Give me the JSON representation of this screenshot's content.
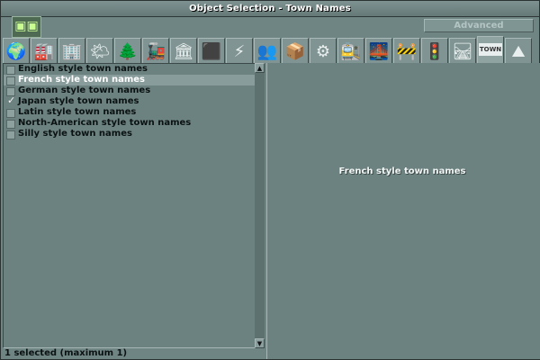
{
  "window": {
    "title": "Object Selection - Town Names"
  },
  "toolbar": {
    "advanced_label": "Advanced"
  },
  "tabs": [
    {
      "name": "world",
      "icon": "🌍"
    },
    {
      "name": "industries",
      "icon": "🏭"
    },
    {
      "name": "houses",
      "icon": "🏢"
    },
    {
      "name": "climate",
      "icon": "🌤"
    },
    {
      "name": "trees",
      "icon": "🌲"
    },
    {
      "name": "trains",
      "icon": "🚂"
    },
    {
      "name": "stations",
      "icon": "🏛"
    },
    {
      "name": "terrain",
      "icon": "⬛"
    },
    {
      "name": "electric",
      "icon": "⚡"
    },
    {
      "name": "people",
      "icon": "👥"
    },
    {
      "name": "cargo",
      "icon": "📦"
    },
    {
      "name": "config",
      "icon": "⚙"
    },
    {
      "name": "passengers",
      "icon": "🚉"
    },
    {
      "name": "bridges",
      "icon": "🌉"
    },
    {
      "name": "road-signs",
      "icon": "🚧"
    },
    {
      "name": "signals",
      "icon": "🚦"
    },
    {
      "name": "track",
      "icon": "🛤"
    },
    {
      "name": "town",
      "icon": "TOWN"
    },
    {
      "name": "hills",
      "icon": "⛰"
    }
  ],
  "selected_tab": "town",
  "list": {
    "items": [
      {
        "label": "English style town names",
        "checked": false,
        "highlighted": false
      },
      {
        "label": "French style town names",
        "checked": false,
        "highlighted": true
      },
      {
        "label": "German style town names",
        "checked": false,
        "highlighted": false
      },
      {
        "label": "Japan style town names",
        "checked": true,
        "highlighted": false
      },
      {
        "label": "Latin style town names",
        "checked": false,
        "highlighted": false
      },
      {
        "label": "North-American style town names",
        "checked": false,
        "highlighted": false
      },
      {
        "label": "Silly style town names",
        "checked": false,
        "highlighted": false
      }
    ]
  },
  "info": {
    "text": "French style town names"
  },
  "status": {
    "text": "1 selected (maximum 1)"
  },
  "colors": {
    "background": "#6f8584",
    "highlight": "#889c9b",
    "text_dark": "#0b1212",
    "text_light": "#ffffff"
  }
}
